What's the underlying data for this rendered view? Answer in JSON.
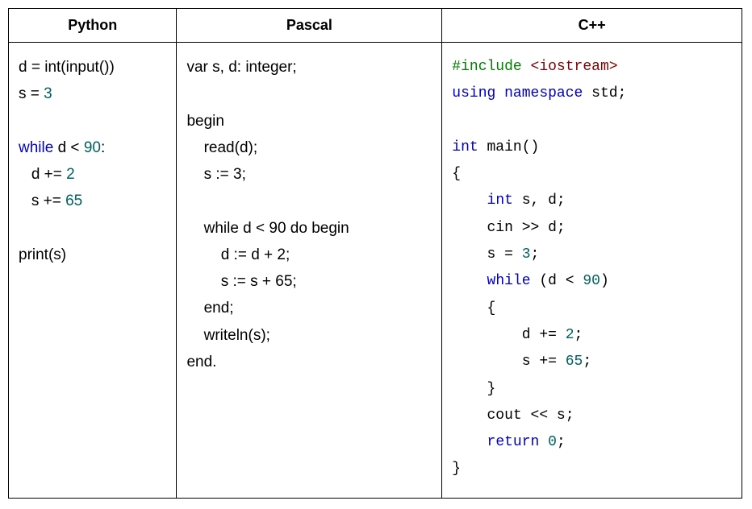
{
  "columns": {
    "python": "Python",
    "pascal": "Pascal",
    "cpp": "C++"
  },
  "code": {
    "python_html": "d = int(input())\ns = <span class=\"num\">3</span>\n\n<span class=\"kw\">while</span> d &lt; <span class=\"num\">90</span>:\n   d += <span class=\"num\">2</span>\n   s += <span class=\"num\">65</span>\n\nprint(s)",
    "pascal_html": "var s, d: integer;\n\nbegin\n    read(d);\n    s := 3;\n\n    while d &lt; 90 do begin\n        d := d + 2;\n        s := s + 65;\n    end;\n    writeln(s);\nend.",
    "cpp_html": "<span class=\"pp\">#include</span> <span class=\"inc\">&lt;iostream&gt;</span>\n<span class=\"kw\">using</span> <span class=\"kw\">namespace</span> std;\n\n<span class=\"kw\">int</span> main()\n{\n    <span class=\"kw\">int</span> s, d;\n    cin &gt;&gt; d;\n    s = <span class=\"num\">3</span>;\n    <span class=\"kw\">while</span> (d &lt; <span class=\"num\">90</span>)\n    {\n        d += <span class=\"num\">2</span>;\n        s += <span class=\"num\">65</span>;\n    }\n    cout &lt;&lt; s;\n    <span class=\"kw\">return</span> <span class=\"num\">0</span>;\n}"
  }
}
